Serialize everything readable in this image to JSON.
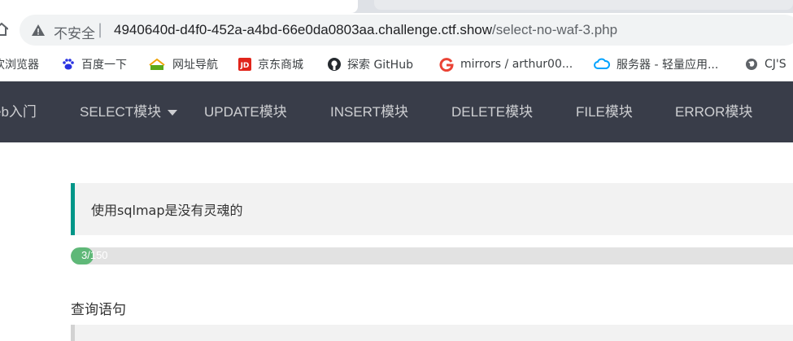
{
  "browser": {
    "security_label": "不安全",
    "separator": "|",
    "url_host": "4940640d-d4f0-452a-a4bd-66e0da0803aa.challenge.ctf.show",
    "url_path": "/select-no-waf-3.php"
  },
  "bookmarks": [
    {
      "label": "欢浏览器",
      "icon": "browser-icon"
    },
    {
      "label": "百度一下",
      "icon": "baidu-paw-icon",
      "color": "#2932e1"
    },
    {
      "label": "网址导航",
      "icon": "2345-icon",
      "color": "#5aa919"
    },
    {
      "label": "京东商城",
      "icon": "jd-icon",
      "color": "#e1251b"
    },
    {
      "label": "探索 GitHub",
      "icon": "github-icon",
      "color": "#24292e"
    },
    {
      "label": "mirrors / arthur00...",
      "icon": "google-g-icon",
      "color": "#ea4335"
    },
    {
      "label": "服务器 - 轻量应用...",
      "icon": "cloud-icon",
      "color": "#00a3ff"
    },
    {
      "label": "CJ'S",
      "icon": "globe-icon",
      "color": "#5f6368"
    }
  ],
  "nav": {
    "items": [
      {
        "label": "eb入门"
      },
      {
        "label": "SELECT模块",
        "has_caret": true
      },
      {
        "label": "UPDATE模块"
      },
      {
        "label": "INSERT模块"
      },
      {
        "label": "DELETE模块"
      },
      {
        "label": "FILE模块"
      },
      {
        "label": "ERROR模块"
      }
    ],
    "background": "#393d49"
  },
  "main": {
    "quote": "使用sqlmap是没有灵魂的",
    "progress": {
      "text": "3/150",
      "value": 3,
      "max": 150,
      "color": "#5fb878"
    },
    "section_title": "查询语句"
  }
}
